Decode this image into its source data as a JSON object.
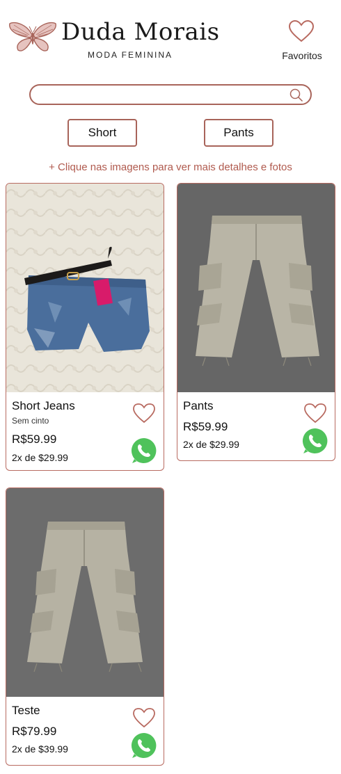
{
  "brand": {
    "name": "Duda Morais",
    "subtitle": "MODA FEMININA"
  },
  "header": {
    "favorites_label": "Favoritos"
  },
  "search": {
    "value": "",
    "placeholder": ""
  },
  "categories": [
    {
      "label": "Short"
    },
    {
      "label": "Pants"
    }
  ],
  "hint": "+ Clique nas imagens para ver mais detalhes e fotos",
  "products": [
    {
      "name": "Short Jeans",
      "subtitle": "Sem cinto",
      "price": "R$59.99",
      "installments": "2x de $29.99",
      "image": "denim-shorts-photo"
    },
    {
      "name": "Pants",
      "subtitle": "",
      "price": "R$59.99",
      "installments": "2x de $29.99",
      "image": "cargo-pants-photo"
    },
    {
      "name": "Teste",
      "subtitle": "",
      "price": "R$79.99",
      "installments": "2x de $39.99",
      "image": "cargo-pants-photo"
    }
  ],
  "colors": {
    "accent": "#a8645a",
    "hint_text": "#b05a4e",
    "whatsapp": "#4fc25b",
    "heart_stroke": "#b86a60"
  },
  "icons": {
    "logo": "butterfly-icon",
    "favorites": "heart-icon",
    "search": "search-icon",
    "product_favorite": "heart-icon",
    "whatsapp": "whatsapp-icon"
  }
}
